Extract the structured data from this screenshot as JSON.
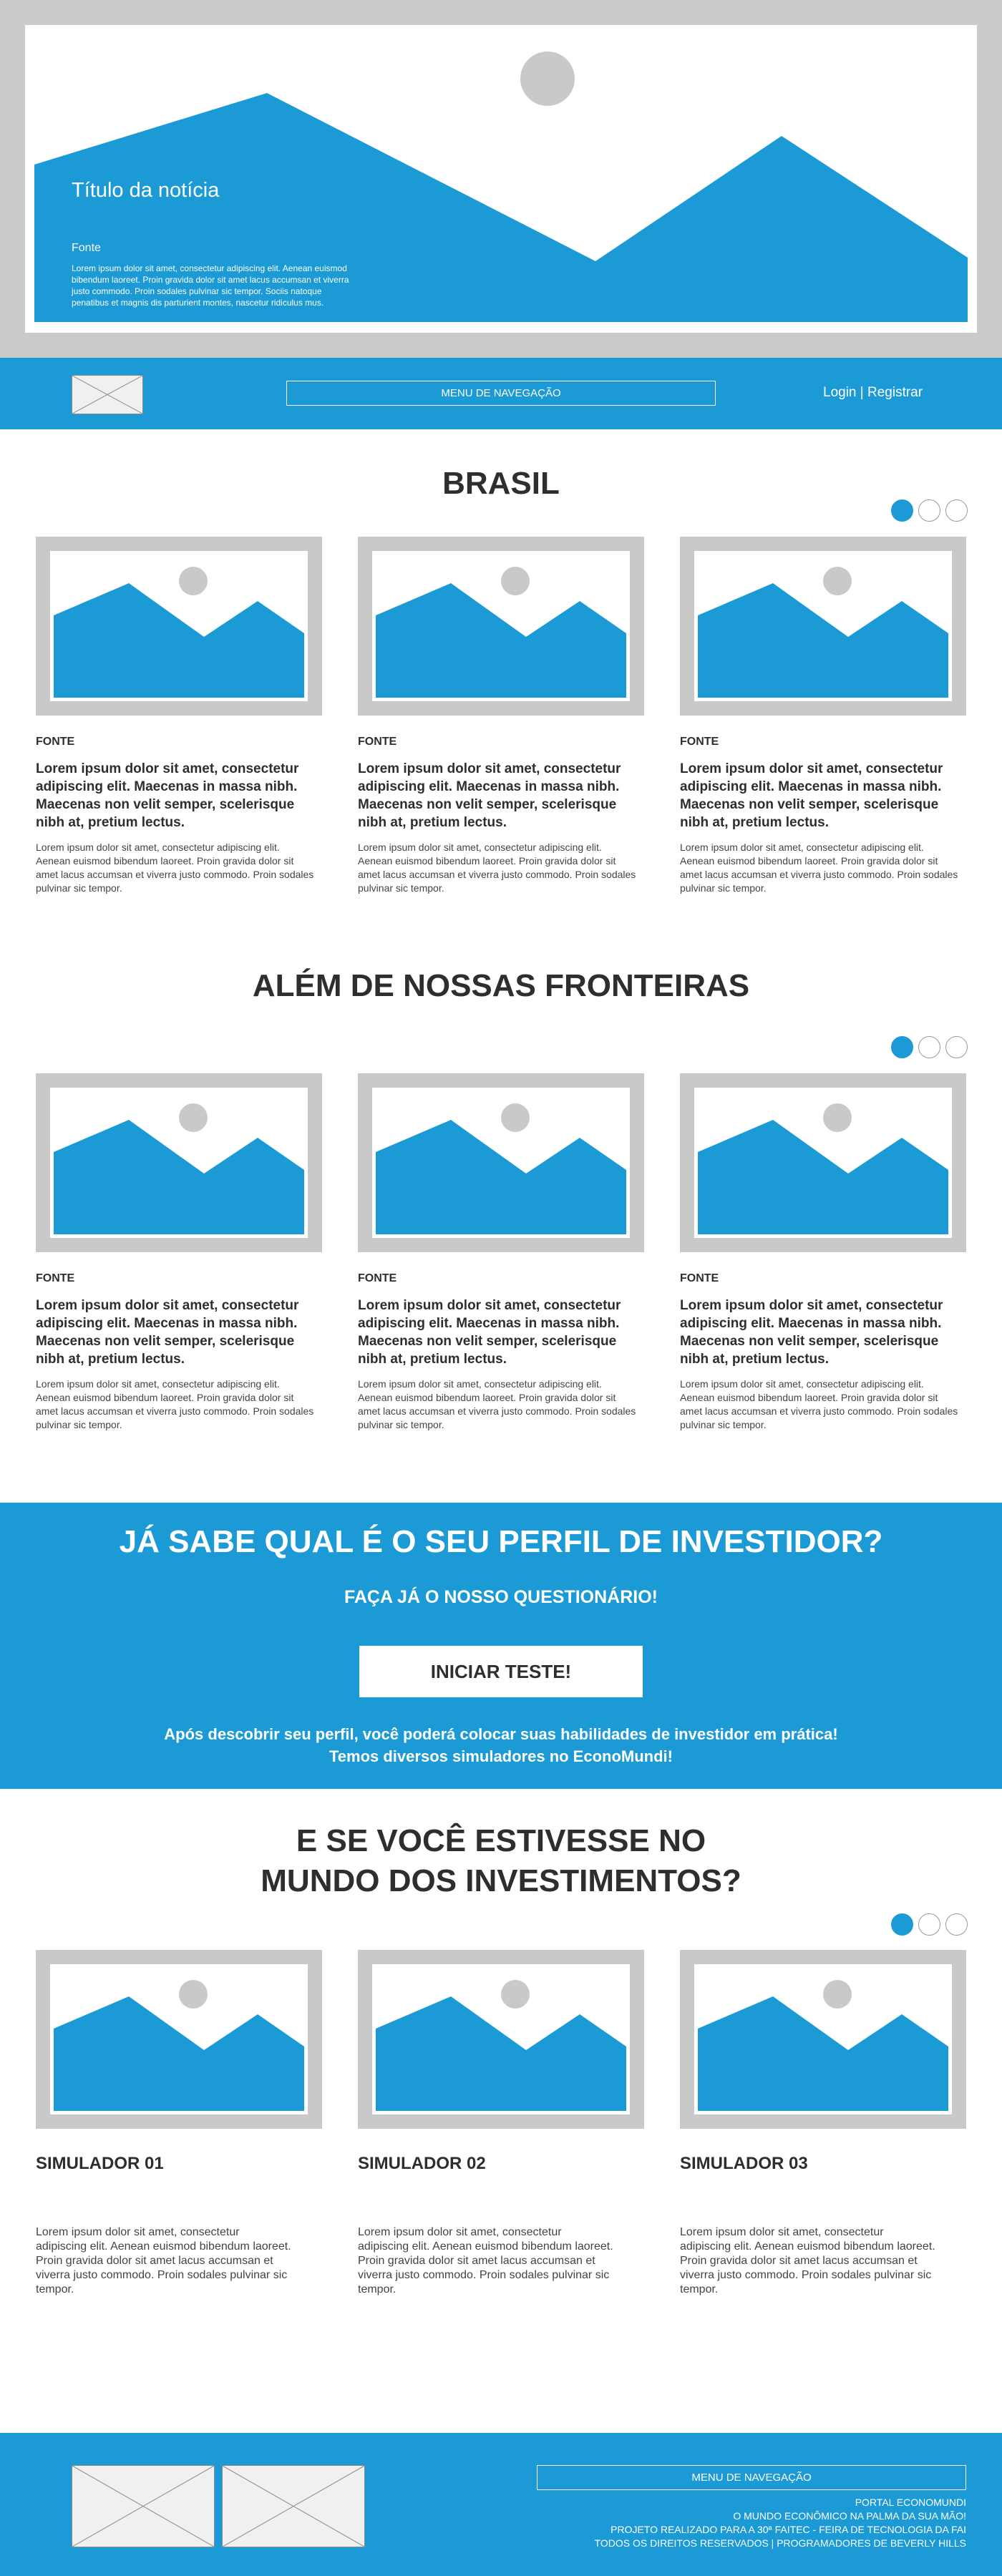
{
  "colors": {
    "accent": "#1b9ad6",
    "placeholder_gray": "#c9c9c9",
    "text_dark": "#2e2e2e"
  },
  "hero": {
    "title": "Título da notícia",
    "fonte": "Fonte",
    "description": "Lorem ipsum dolor sit amet, consectetur adipiscing elit. Aenean euismod bibendum laoreet. Proin gravida dolor sit amet lacus accumsan et viverra justo commodo. Proin sodales pulvinar sic tempor. Sociis natoque penatibus et magnis dis parturient montes, nascetur ridiculus mus."
  },
  "nav": {
    "logo_icon": "image-placeholder-icon",
    "menu_label": "MENU DE NAVEGAÇÃO",
    "login_label": "Login",
    "separator": "|",
    "register_label": "Registrar"
  },
  "sections": {
    "brasil": {
      "title": "BRASIL",
      "cards": [
        {
          "fonte": "FONTE",
          "headline": "Lorem ipsum dolor sit amet, consectetur adipiscing elit. Maecenas in massa nibh. Maecenas non velit semper, scelerisque nibh at, pretium lectus.",
          "text": "Lorem ipsum dolor sit amet, consectetur adipiscing elit. Aenean euismod bibendum laoreet. Proin gravida dolor sit amet lacus accumsan et viverra justo commodo. Proin sodales pulvinar sic tempor."
        },
        {
          "fonte": "FONTE",
          "headline": "Lorem ipsum dolor sit amet, consectetur adipiscing elit. Maecenas in massa nibh. Maecenas non velit semper, scelerisque nibh at, pretium lectus.",
          "text": "Lorem ipsum dolor sit amet, consectetur adipiscing elit. Aenean euismod bibendum laoreet. Proin gravida dolor sit amet lacus accumsan et viverra justo commodo. Proin sodales pulvinar sic tempor."
        },
        {
          "fonte": "FONTE",
          "headline": "Lorem ipsum dolor sit amet, consectetur adipiscing elit. Maecenas in massa nibh. Maecenas non velit semper, scelerisque nibh at, pretium lectus.",
          "text": "Lorem ipsum dolor sit amet, consectetur adipiscing elit. Aenean euismod bibendum laoreet. Proin gravida dolor sit amet lacus accumsan et viverra justo commodo. Proin sodales pulvinar sic tempor."
        }
      ]
    },
    "fronteiras": {
      "title": "ALÉM DE NOSSAS FRONTEIRAS",
      "cards": [
        {
          "fonte": "FONTE",
          "headline": "Lorem ipsum dolor sit amet, consectetur adipiscing elit. Maecenas in massa nibh. Maecenas non velit semper, scelerisque nibh at, pretium lectus.",
          "text": "Lorem ipsum dolor sit amet, consectetur adipiscing elit. Aenean euismod bibendum laoreet. Proin gravida dolor sit amet lacus accumsan et viverra justo commodo. Proin sodales pulvinar sic tempor."
        },
        {
          "fonte": "FONTE",
          "headline": "Lorem ipsum dolor sit amet, consectetur adipiscing elit. Maecenas in massa nibh. Maecenas non velit semper, scelerisque nibh at, pretium lectus.",
          "text": "Lorem ipsum dolor sit amet, consectetur adipiscing elit. Aenean euismod bibendum laoreet. Proin gravida dolor sit amet lacus accumsan et viverra justo commodo. Proin sodales pulvinar sic tempor."
        },
        {
          "fonte": "FONTE",
          "headline": "Lorem ipsum dolor sit amet, consectetur adipiscing elit. Maecenas in massa nibh. Maecenas non velit semper, scelerisque nibh at, pretium lectus.",
          "text": "Lorem ipsum dolor sit amet, consectetur adipiscing elit. Aenean euismod bibendum laoreet. Proin gravida dolor sit amet lacus accumsan et viverra justo commodo. Proin sodales pulvinar sic tempor."
        }
      ]
    },
    "simuladores": {
      "title_line1": "E SE VOCÊ ESTIVESSE NO",
      "title_line2": "MUNDO DOS INVESTIMENTOS?",
      "cards": [
        {
          "title": "SIMULADOR 01",
          "text": "Lorem ipsum dolor sit amet, consectetur adipiscing elit. Aenean euismod bibendum laoreet. Proin gravida dolor sit amet lacus accumsan et viverra justo commodo. Proin sodales pulvinar sic tempor."
        },
        {
          "title": "SIMULADOR 02",
          "text": "Lorem ipsum dolor sit amet, consectetur adipiscing elit. Aenean euismod bibendum laoreet. Proin gravida dolor sit amet lacus accumsan et viverra justo commodo. Proin sodales pulvinar sic tempor."
        },
        {
          "title": "SIMULADOR 03",
          "text": "Lorem ipsum dolor sit amet, consectetur adipiscing elit. Aenean euismod bibendum laoreet. Proin gravida dolor sit amet lacus accumsan et viverra justo commodo. Proin sodales pulvinar sic tempor."
        }
      ]
    }
  },
  "carousel": {
    "dot_count": 3,
    "active_index": 0
  },
  "cta": {
    "title": "JÁ SABE QUAL É O SEU PERFIL DE INVESTIDOR?",
    "subtitle": "FAÇA JÁ O NOSSO QUESTIONÁRIO!",
    "button_label": "INICIAR TESTE!",
    "note_line1": "Após descobrir seu perfil, você poderá colocar suas habilidades de investidor em prática!",
    "note_line2": "Temos diversos simuladores no EconoMundi!"
  },
  "footer": {
    "menu_label": "MENU DE NAVEGAÇÃO",
    "lines": [
      "PORTAL ECONOMUNDI",
      "O MUNDO ECONÔMICO NA PALMA DA SUA MÃO!",
      "PROJETO REALIZADO PARA A 30ª FAITEC - FEIRA DE TECNOLOGIA DA FAI",
      "TODOS OS DIREITOS RESERVADOS | PROGRAMADORES DE BEVERLY HILLS"
    ],
    "logo_icons": [
      "image-placeholder-icon",
      "image-placeholder-icon"
    ]
  }
}
